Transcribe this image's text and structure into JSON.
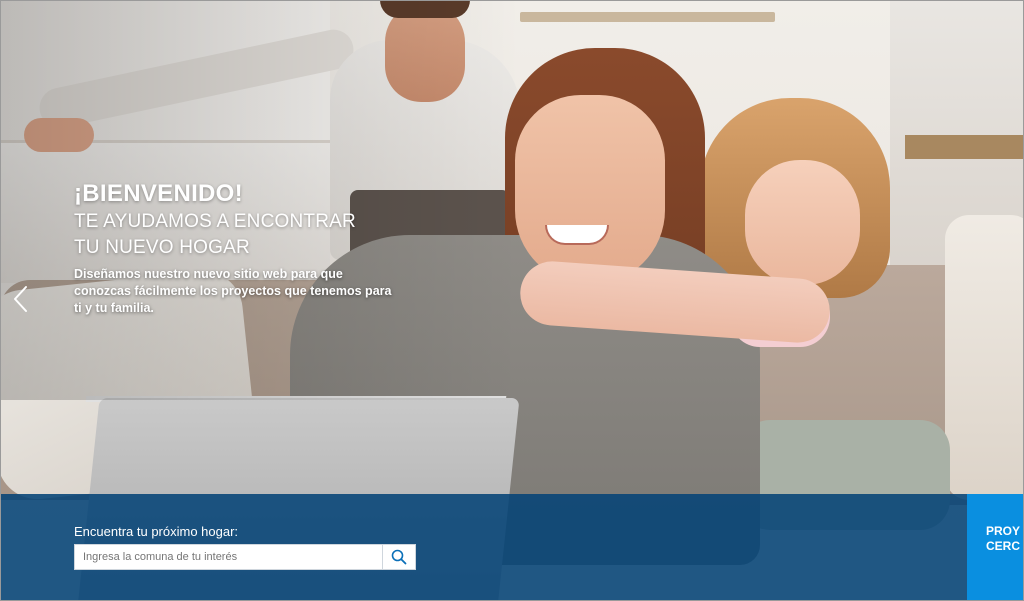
{
  "hero": {
    "title": "¡BIENVENIDO!",
    "subtitle_line1": "TE AYUDAMOS A ENCONTRAR",
    "subtitle_line2": "TU NUEVO HOGAR",
    "description": "Diseñamos nuestro nuevo sitio web para que conozcas fácilmente los proyectos que tenemos para ti y tu familia.",
    "prev_icon": "chevron-left-icon"
  },
  "search": {
    "label": "Encuentra tu próximo hogar:",
    "placeholder": "Ingresa la comuna de tu interés",
    "button_icon": "search-icon"
  },
  "cta": {
    "line1": "PROY",
    "line2": "CERC"
  },
  "colors": {
    "search_band": "#044376",
    "cta_blue": "#0a8fe0"
  }
}
